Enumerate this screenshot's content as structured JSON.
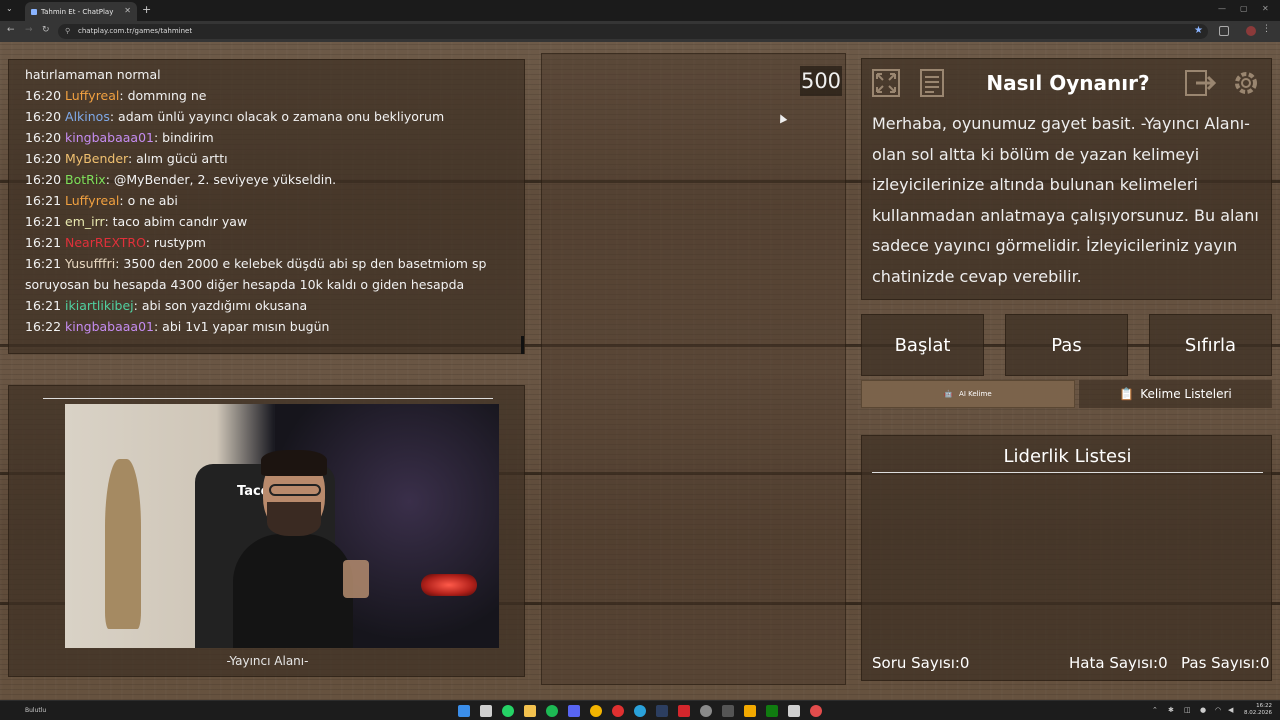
{
  "browser": {
    "tab_title": "Tahmin Et - ChatPlay",
    "url": "chatplay.com.tr/games/tahminet"
  },
  "chat": {
    "messages": [
      {
        "time": "",
        "user": "",
        "user_color": "#f2f2f2",
        "text": "hatırlamaman normal"
      },
      {
        "time": "16:20",
        "user": "Luffyreal",
        "user_color": "#f0a040",
        "text": ": dommıng ne"
      },
      {
        "time": "16:20",
        "user": "Alkinos",
        "user_color": "#7fa9e8",
        "text": ": adam ünlü yayıncı olacak o zamana onu bekliyorum"
      },
      {
        "time": "16:20",
        "user": "kingbabaaa01",
        "user_color": "#c58cf0",
        "text": ": bindirim"
      },
      {
        "time": "16:20",
        "user": "MyBender",
        "user_color": "#f0c070",
        "text": ": alım gücü arttı"
      },
      {
        "time": "16:20",
        "user": "BotRix",
        "user_color": "#7ee05a",
        "text": ": @MyBender, 2. seviyeye yükseldin."
      },
      {
        "time": "16:21",
        "user": "Luffyreal",
        "user_color": "#f0a040",
        "text": ": o ne abi"
      },
      {
        "time": "16:21",
        "user": "em_irr",
        "user_color": "#e8e8b0",
        "text": ": taco abim candır yaw"
      },
      {
        "time": "16:21",
        "user": "NearREXTRO",
        "user_color": "#e0303a",
        "text": ": rustypm"
      },
      {
        "time": "16:21",
        "user": "Yusufffri",
        "user_color": "#e8d8c0",
        "text": ": 3500 den 2000 e kelebek düşdü abi sp den basetmiom sp soruyosan bu hesapda 4300 diğer hesapda 10k kaldı o giden hesapda"
      },
      {
        "time": "16:21",
        "user": "ikiartlikibej",
        "user_color": "#50d0a0",
        "text": ": abi son yazdığımı okusana"
      },
      {
        "time": "16:22",
        "user": "kingbabaaa01",
        "user_color": "#c58cf0",
        "text": ": abi 1v1 yapar mısın bugün"
      }
    ]
  },
  "streamer": {
    "label": "-Yayıncı Alanı-",
    "overlay_text": "Taco"
  },
  "board": {
    "score": "500"
  },
  "howto": {
    "title": "Nasıl Oynanır?",
    "text": "Merhaba, oyunumuz gayet basit. -Yayıncı Alanı- olan sol altta ki bölüm de yazan kelimeyi izleyicilerinize altında bulunan kelimeleri kullanmadan anlatmaya çalışıyorsunuz. Bu alanı sadece yayıncı görmelidir. İzleyicileriniz yayın chatinizde cevap verebilir."
  },
  "controls": {
    "start": "Başlat",
    "pass": "Pas",
    "reset": "Sıfırla",
    "ai_word": "AI Kelime",
    "word_lists": "Kelime Listeleri"
  },
  "leaderboard": {
    "title": "Liderlik Listesi",
    "question_count": "Soru Sayısı:0",
    "error_count": "Hata Sayısı:0",
    "pass_count": "Pas Sayısı:0"
  },
  "taskbar": {
    "time": "16:22",
    "date": "8.02.2026",
    "weather_label": "Bulutlu"
  },
  "icons": {
    "fullscreen": "fullscreen-icon",
    "notes": "notes-icon",
    "exit": "exit-icon",
    "settings": "gear-icon"
  },
  "colors": {
    "panel": "#3e3024",
    "accent_button": "#7b634b"
  }
}
